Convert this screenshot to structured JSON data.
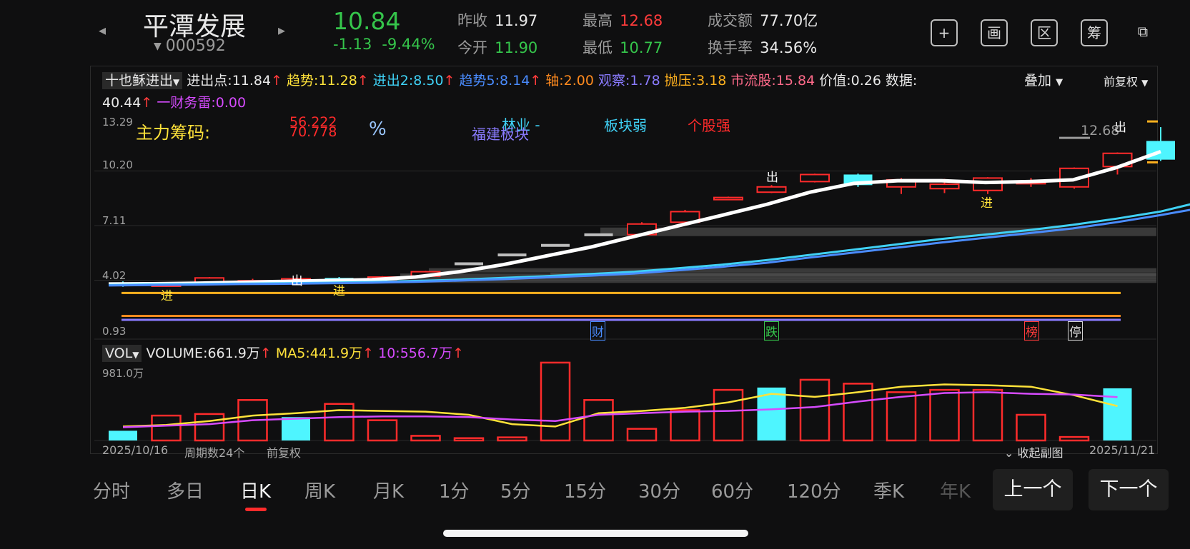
{
  "header": {
    "stock_name": "平潭发展",
    "stock_code": "000592",
    "price": "10.84",
    "change": "-1.13",
    "change_pct": "-9.44%",
    "quotes": [
      {
        "label": "昨收",
        "value": "11.97",
        "color": "white"
      },
      {
        "label": "今开",
        "value": "11.90",
        "color": "green"
      },
      {
        "label": "最高",
        "value": "12.68",
        "color": "red"
      },
      {
        "label": "最低",
        "value": "10.77",
        "color": "green"
      },
      {
        "label": "成交额",
        "value": "77.70亿",
        "color": "white"
      },
      {
        "label": "换手率",
        "value": "34.56%",
        "color": "white"
      }
    ],
    "icons": [
      {
        "name": "add-icon",
        "glyph": "+"
      },
      {
        "name": "picture-icon",
        "glyph": "画"
      },
      {
        "name": "range-icon",
        "glyph": "区"
      },
      {
        "name": "chip-icon",
        "glyph": "筹"
      },
      {
        "name": "device-switch-icon",
        "glyph": "⧉"
      }
    ]
  },
  "indicator": {
    "selector": "十也稣进出",
    "overlay": "叠加",
    "adjust": "前复权",
    "items": [
      {
        "label": "进出点:",
        "value": "11.84",
        "arrow": "↑",
        "color": "#e8e8e8"
      },
      {
        "label": "趋势:",
        "value": "11.28",
        "arrow": "↑",
        "color": "#ffe23a"
      },
      {
        "label": "进出2:",
        "value": "8.50",
        "arrow": "↑",
        "color": "#3fd1f5"
      },
      {
        "label": "趋势5:",
        "value": "8.14",
        "arrow": "↑",
        "color": "#4a8cff"
      },
      {
        "label": "轴:",
        "value": "2.00",
        "arrow": "",
        "color": "#ff8a1e"
      },
      {
        "label": "观察:",
        "value": "1.78",
        "arrow": "",
        "color": "#8a7bff"
      },
      {
        "label": "抛压:",
        "value": "3.18",
        "arrow": "",
        "color": "#ffb11e"
      },
      {
        "label": "市流股:",
        "value": "15.84",
        "arrow": "",
        "color": "#ff6a8a"
      },
      {
        "label": "价值:",
        "value": "0.26",
        "arrow": "",
        "color": "#e8e8e8"
      },
      {
        "label": "数据:",
        "value": "",
        "arrow": "",
        "color": "#e8e8e8"
      }
    ],
    "line2_value": "40.44",
    "line2_label": "一财务雷:",
    "line2_val2": "0.00"
  },
  "chart_overlay_text": {
    "main": "主力筹码:",
    "v1": "56.222",
    "v2": "70.778",
    "pct": "%",
    "sector": "福建板块",
    "industry": "林业 -",
    "weak": "板块弱",
    "strong": "个股强",
    "high_label": "12.68",
    "out1": "出",
    "out2": "出",
    "out3": "出",
    "in1": "进",
    "in2": "进",
    "in3": "进",
    "tag_cai": "财",
    "tag_die": "跌",
    "tag_bang": "榜",
    "tag_ting": "停"
  },
  "y_axis": [
    "13.29",
    "10.20",
    "7.11",
    "4.02",
    "0.93"
  ],
  "volume": {
    "selector": "VOL",
    "label": "VOLUME:",
    "value": "661.9万",
    "ma5_label": "MA5:",
    "ma5": "441.9万",
    "ma10_label": "10:",
    "ma10": "556.7万",
    "ymax": "981.0万"
  },
  "footer": {
    "start_date": "2025/10/16",
    "periods": "周期数24个",
    "adjust": "前复权",
    "collapse": "收起副图",
    "end_date": "2025/11/21"
  },
  "tabs": [
    "分时",
    "多日",
    "日K",
    "周K",
    "月K",
    "1分",
    "5分",
    "15分",
    "30分",
    "60分",
    "120分",
    "季K",
    "年K"
  ],
  "buttons": {
    "prev": "上一个",
    "next": "下一个"
  },
  "chart_data": {
    "type": "candlestick",
    "title": "",
    "ylim": [
      0.93,
      13.29
    ],
    "y_ticks": [
      13.29,
      10.2,
      7.11,
      4.02,
      0.93
    ],
    "candles": [
      {
        "o": 3.7,
        "c": 3.9,
        "h": 3.95,
        "l": 3.65,
        "up": false
      },
      {
        "o": 3.8,
        "c": 3.7,
        "h": 3.9,
        "l": 3.65,
        "up": true
      },
      {
        "o": 3.85,
        "c": 4.15,
        "h": 4.2,
        "l": 3.8,
        "up": true
      },
      {
        "o": 3.95,
        "c": 4.0,
        "h": 4.1,
        "l": 3.9,
        "up": true
      },
      {
        "o": 4.1,
        "c": 4.05,
        "h": 4.15,
        "l": 4.0,
        "up": true
      },
      {
        "o": 4.15,
        "c": 3.9,
        "h": 4.2,
        "l": 3.85,
        "up": false
      },
      {
        "o": 4.0,
        "c": 4.2,
        "h": 4.25,
        "l": 3.95,
        "up": true
      },
      {
        "o": 4.25,
        "c": 4.5,
        "h": 4.55,
        "l": 4.2,
        "up": true
      },
      {
        "o": 4.95,
        "c": 4.95,
        "h": 4.95,
        "l": 4.95,
        "up": true,
        "flat": "gray"
      },
      {
        "o": 5.45,
        "c": 5.45,
        "h": 5.45,
        "l": 5.45,
        "up": true,
        "flat": "gray"
      },
      {
        "o": 5.99,
        "c": 5.99,
        "h": 5.99,
        "l": 5.99,
        "up": true,
        "flat": "gray"
      },
      {
        "o": 6.59,
        "c": 6.59,
        "h": 6.59,
        "l": 6.59,
        "up": true,
        "flat": "gray"
      },
      {
        "o": 6.6,
        "c": 7.2,
        "h": 7.3,
        "l": 6.5,
        "up": true
      },
      {
        "o": 7.3,
        "c": 7.9,
        "h": 8.0,
        "l": 7.2,
        "up": true
      },
      {
        "o": 8.6,
        "c": 8.7,
        "h": 8.75,
        "l": 8.55,
        "up": true
      },
      {
        "o": 9.0,
        "c": 9.3,
        "h": 9.4,
        "l": 8.95,
        "up": true
      },
      {
        "o": 9.6,
        "c": 10.0,
        "h": 10.05,
        "l": 9.55,
        "up": true
      },
      {
        "o": 10.0,
        "c": 9.4,
        "h": 10.05,
        "l": 9.3,
        "up": false
      },
      {
        "o": 9.7,
        "c": 9.3,
        "h": 9.8,
        "l": 8.9,
        "up": true
      },
      {
        "o": 9.45,
        "c": 9.2,
        "h": 9.75,
        "l": 8.95,
        "up": true
      },
      {
        "o": 9.8,
        "c": 9.1,
        "h": 9.85,
        "l": 8.9,
        "up": true
      },
      {
        "o": 9.6,
        "c": 9.5,
        "h": 9.8,
        "l": 9.3,
        "up": true
      },
      {
        "o": 9.3,
        "c": 10.35,
        "h": 10.4,
        "l": 9.2,
        "up": true
      },
      {
        "o": 10.45,
        "c": 11.2,
        "h": 11.25,
        "l": 10.0,
        "up": true
      },
      {
        "o": 11.9,
        "c": 10.84,
        "h": 12.68,
        "l": 10.77,
        "up": false
      }
    ],
    "series": [
      {
        "name": "进出点",
        "color": "#ffffff",
        "values": [
          3.8,
          3.82,
          3.85,
          3.9,
          3.95,
          4.0,
          4.05,
          4.2,
          4.5,
          4.9,
          5.4,
          5.9,
          6.5,
          7.1,
          7.7,
          8.3,
          9.0,
          9.5,
          9.65,
          9.65,
          9.55,
          9.6,
          9.7,
          10.4,
          11.3
        ]
      },
      {
        "name": "进出2",
        "color": "#3fd1f5",
        "values": [
          3.75,
          3.78,
          3.8,
          3.83,
          3.85,
          3.88,
          3.92,
          3.98,
          4.05,
          4.15,
          4.25,
          4.37,
          4.5,
          4.7,
          4.9,
          5.15,
          5.45,
          5.75,
          6.05,
          6.35,
          6.6,
          6.85,
          7.15,
          7.5,
          7.9,
          8.5
        ]
      },
      {
        "name": "趋势5",
        "color": "#4a8cff",
        "values": [
          3.72,
          3.75,
          3.77,
          3.8,
          3.82,
          3.85,
          3.88,
          3.93,
          4.0,
          4.08,
          4.18,
          4.28,
          4.4,
          4.58,
          4.78,
          5.0,
          5.3,
          5.58,
          5.86,
          6.15,
          6.42,
          6.68,
          6.95,
          7.3,
          7.7,
          8.14
        ]
      }
    ],
    "volume": {
      "ylim": [
        0,
        981.0
      ],
      "values": [
        125,
        320,
        340,
        520,
        300,
        470,
        260,
        60,
        30,
        40,
        1000,
        520,
        150,
        390,
        650,
        680,
        780,
        730,
        620,
        650,
        650,
        330,
        45,
        670
      ],
      "up": [
        false,
        true,
        true,
        true,
        false,
        true,
        true,
        true,
        true,
        true,
        true,
        true,
        true,
        true,
        true,
        false,
        true,
        true,
        true,
        true,
        true,
        true,
        true,
        false
      ],
      "ma5": [
        180,
        200,
        250,
        320,
        350,
        390,
        380,
        370,
        330,
        210,
        180,
        350,
        380,
        420,
        490,
        600,
        560,
        620,
        690,
        720,
        710,
        690,
        580,
        441.9
      ],
      "ma10": [
        170,
        190,
        210,
        260,
        280,
        300,
        310,
        310,
        300,
        270,
        250,
        330,
        350,
        370,
        380,
        400,
        430,
        500,
        560,
        610,
        620,
        600,
        590,
        556.7
      ]
    }
  }
}
